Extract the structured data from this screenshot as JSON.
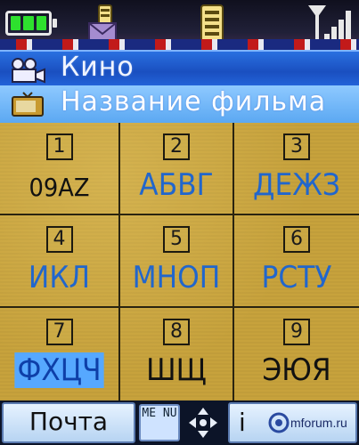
{
  "status": {
    "battery_icon": "battery-full-icon",
    "message_icon": "message-envelope-icon",
    "memory_icon": "memory-card-icon",
    "signal_icon": "signal-strength-icon"
  },
  "header": {
    "category_icon": "camera-icon",
    "category_label": "Кино",
    "field_icon": "tv-icon",
    "field_label": "Название фильма"
  },
  "keypad": {
    "keys": [
      {
        "num": "1",
        "chars": "09AZ"
      },
      {
        "num": "2",
        "chars": "АБВГ"
      },
      {
        "num": "3",
        "chars": "ДЕЖЗ"
      },
      {
        "num": "4",
        "chars": "ИКЛ"
      },
      {
        "num": "5",
        "chars": "МНОП"
      },
      {
        "num": "6",
        "chars": "РСТУ"
      },
      {
        "num": "7",
        "chars": "ФХЦЧ"
      },
      {
        "num": "8",
        "chars": "ШЩ"
      },
      {
        "num": "9",
        "chars": "ЭЮЯ"
      }
    ]
  },
  "softkeys": {
    "left_label": "Почта",
    "menu_label": "ME NU",
    "right_label": "i"
  },
  "watermark": {
    "text": "mforum.ru"
  }
}
